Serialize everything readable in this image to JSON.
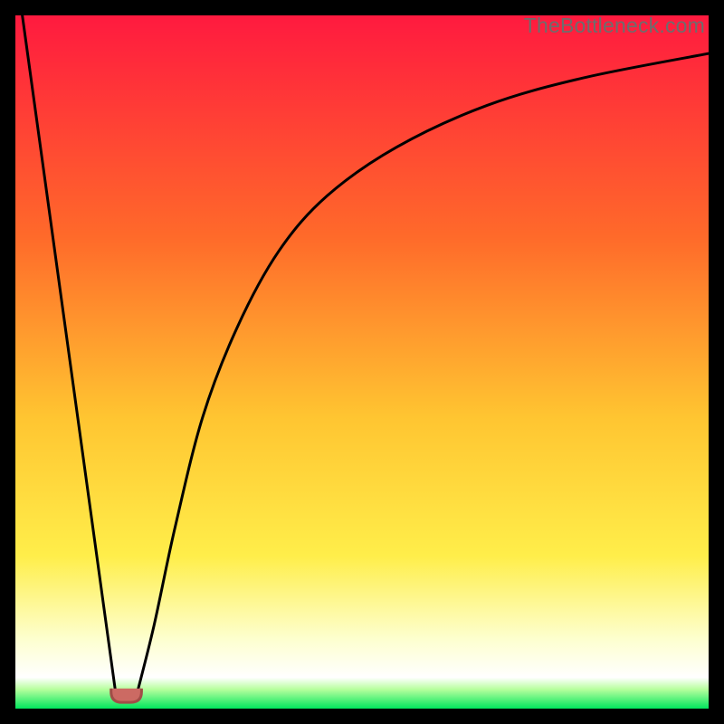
{
  "watermark": "TheBottleneck.com",
  "colors": {
    "page_bg": "#000000",
    "gradient_top": "#ff1a3f",
    "gradient_mid1": "#ff6a2a",
    "gradient_mid2": "#ffc531",
    "gradient_mid3": "#ffee4a",
    "gradient_bottom_pale": "#fdffcf",
    "gradient_green": "#00e65c",
    "curve_stroke": "#000000",
    "marker_fill": "#cc6a63",
    "marker_stroke": "#a14d47"
  },
  "chart_data": {
    "type": "line",
    "title": "",
    "xlabel": "",
    "ylabel": "",
    "xlim": [
      0,
      100
    ],
    "ylim": [
      0,
      100
    ],
    "series": [
      {
        "name": "left-branch",
        "x": [
          1,
          14.5
        ],
        "y": [
          100,
          2
        ]
      },
      {
        "name": "right-branch",
        "x": [
          17.5,
          20,
          23,
          27,
          32,
          38,
          45,
          55,
          68,
          82,
          100
        ],
        "y": [
          2,
          12,
          26,
          42,
          55,
          66,
          74,
          81,
          87,
          91,
          94.5
        ]
      }
    ],
    "marker": {
      "name": "min-marker",
      "x_center": 16,
      "x_half_width": 2.2,
      "y": 1.5
    },
    "background_gradient_stops": [
      {
        "offset": 0.0,
        "color": "#ff1a3f"
      },
      {
        "offset": 0.32,
        "color": "#ff6a2a"
      },
      {
        "offset": 0.58,
        "color": "#ffc531"
      },
      {
        "offset": 0.78,
        "color": "#ffee4a"
      },
      {
        "offset": 0.9,
        "color": "#fdffcf"
      },
      {
        "offset": 0.955,
        "color": "#ffffff"
      },
      {
        "offset": 0.972,
        "color": "#b8ff9e"
      },
      {
        "offset": 1.0,
        "color": "#00e65c"
      }
    ]
  }
}
